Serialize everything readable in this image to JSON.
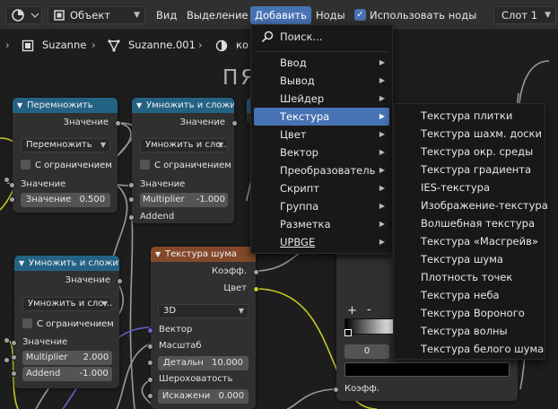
{
  "header": {
    "mode_select": "Объект",
    "menus": [
      "Вид",
      "Выделение",
      "Добавить",
      "Ноды"
    ],
    "use_nodes_label": "Использовать ноды",
    "slot_select": "Слот 1"
  },
  "breadcrumb": {
    "object": "Suzanne",
    "mesh": "Suzanne.001",
    "material": "ко"
  },
  "frame_label": "ПЯ",
  "add_menu": {
    "search_label": "Поиск...",
    "items": [
      "Ввод",
      "Вывод",
      "Шейдер",
      "Текстура",
      "Цвет",
      "Вектор",
      "Преобразователь",
      "Скрипт",
      "Группа",
      "Разметка",
      "UPBGE"
    ]
  },
  "texture_submenu": {
    "items": [
      "Текстура плитки",
      "Текстура шахм. доски",
      "Текстура окр. среды",
      "Текстура градиента",
      "IES-текстура",
      "Изображение-текстура",
      "Волшебная текстура",
      "Текстура «Масгрейв»",
      "Текстура шума",
      "Плотность точек",
      "Текстура неба",
      "Текстура Вороного",
      "Текстура волны",
      "Текстура белого шума"
    ]
  },
  "node_multiply": {
    "title": "Перемножить",
    "out_value": "Значение",
    "op": "Перемножить",
    "clamp": "С ограничением",
    "in_value": "Значение",
    "field_label": "Значение",
    "field_value": "0.500"
  },
  "node_muladd1": {
    "title": "Умножить и сложить",
    "out_value": "Значение",
    "op": "Умножить и сло...",
    "clamp": "С ограничением",
    "in_value": "Значение",
    "mult_label": "Multiplier",
    "mult_value": "-1.000",
    "addend": "Addend"
  },
  "node_muladd2": {
    "title": "Умножить и сложить",
    "out_value": "Значение",
    "op": "Умножить и сло...",
    "clamp": "С ограничением",
    "in_value": "Значение",
    "mult_label": "Multiplier",
    "mult_value": "2.000",
    "addend_label": "Addend",
    "addend_value": "-1.000"
  },
  "node_noise": {
    "title": "Текстура шума",
    "out_fac": "Коэфф.",
    "out_color": "Цвет",
    "dimension": "3D",
    "in_vector": "Вектор",
    "in_scale": "Масштаб",
    "detail_label": "Детальн",
    "detail_value": "10.000",
    "roughness": "Шероховатость",
    "distortion_label": "Искажени",
    "distortion_value": "0.000"
  },
  "node_ramp": {
    "add_stop": "+",
    "remove_stop": "-",
    "position": "0",
    "in_fac": "Коэфф."
  }
}
